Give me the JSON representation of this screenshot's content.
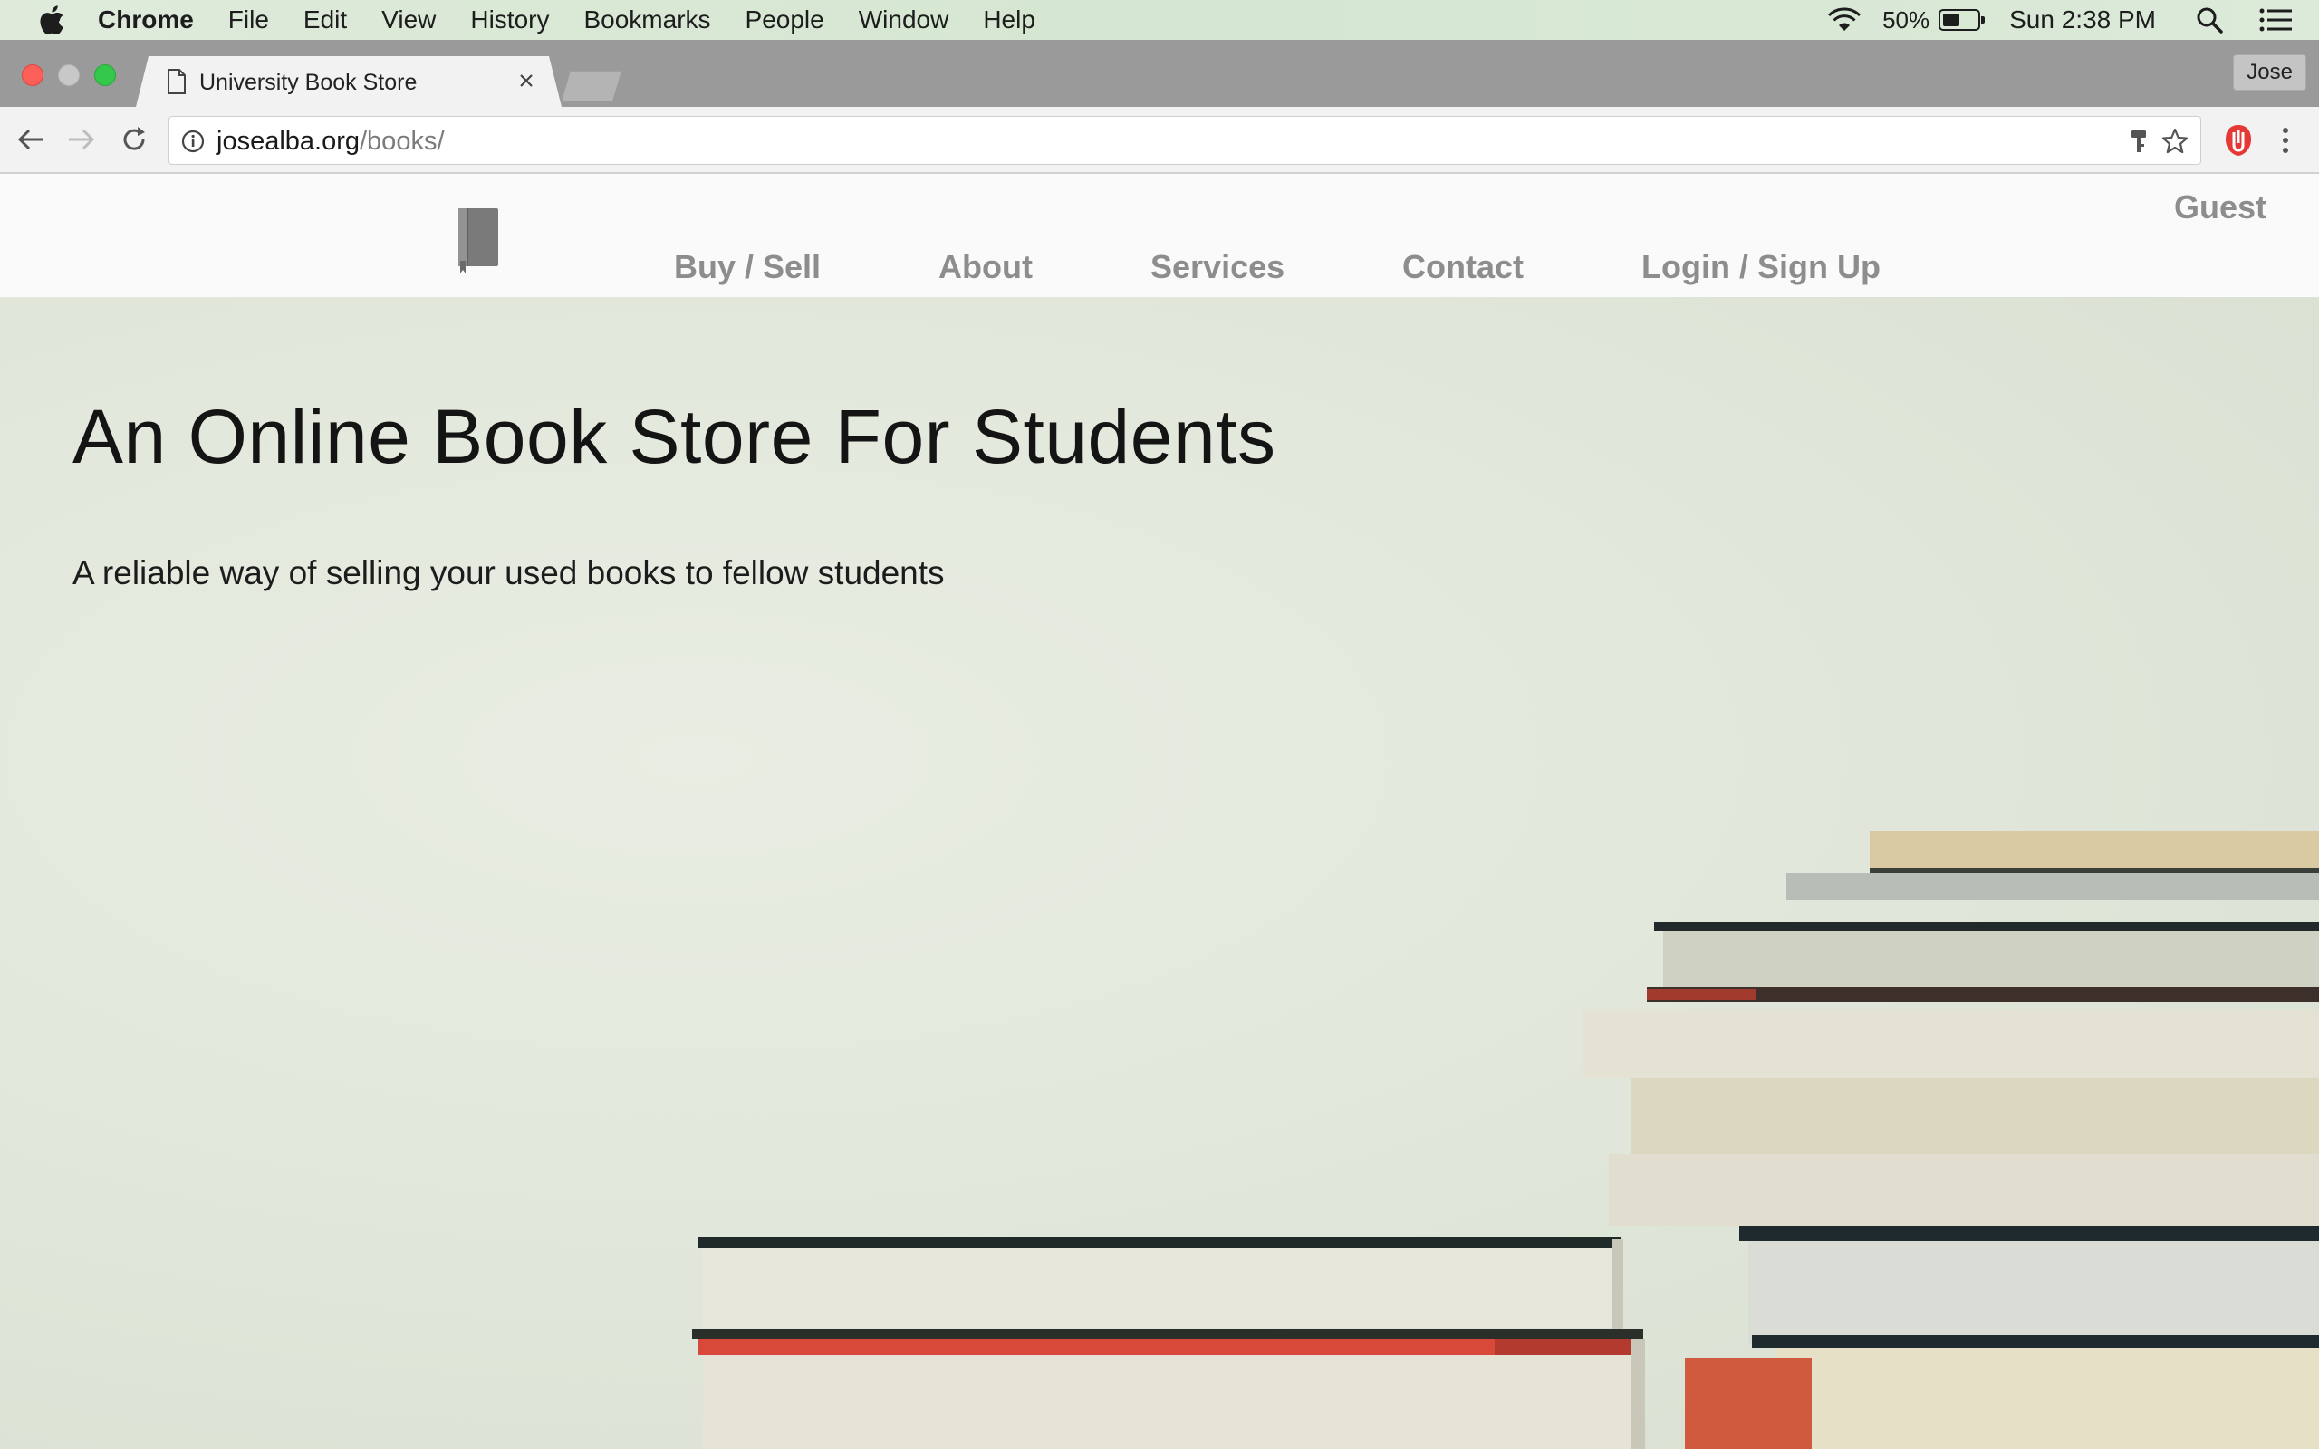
{
  "menubar": {
    "app_name": "Chrome",
    "items": [
      "File",
      "Edit",
      "View",
      "History",
      "Bookmarks",
      "People",
      "Window",
      "Help"
    ],
    "battery_percent": "50%",
    "battery_level": 0.5,
    "clock": "Sun 2:38 PM"
  },
  "browser": {
    "tab_title": "University Book Store",
    "profile_name": "Jose",
    "url_host": "josealba.org",
    "url_path": "/books/"
  },
  "site": {
    "nav": [
      "Buy / Sell",
      "About",
      "Services",
      "Contact",
      "Login / Sign Up"
    ],
    "user_label": "Guest",
    "hero_title": "An Online Book Store For Students",
    "hero_subtitle": "A reliable way of selling your used books to fellow students"
  },
  "colors": {
    "nav_text": "#8d8d8d",
    "close_red": "#fc5f57",
    "maximize_green": "#34c84a",
    "extension_red": "#e53935"
  }
}
